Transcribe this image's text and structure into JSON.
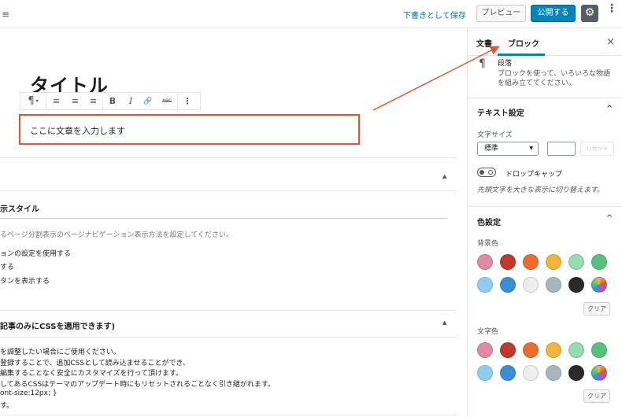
{
  "topbar": {
    "menu_icon": "≡",
    "save_draft": "下書きとして保存",
    "preview": "プレビュー",
    "publish": "公開する",
    "settings_icon": "⚙",
    "more_icon": "⋮"
  },
  "editor": {
    "title": "タイトル",
    "paragraph_text": "ここに文章を入力します",
    "toolbar": {
      "paragraph_icon": "¶",
      "align_left": "≡",
      "align_center": "≡",
      "align_right": "≡",
      "bold": "B",
      "italic": "I",
      "link": "🔗",
      "strikethrough": "ABC",
      "more": "⋮"
    },
    "panel1": {
      "title": "示スタイル",
      "note": "るページ分割表示のページナビゲーション表示方法を設定してください。",
      "options": [
        "ョンの設定を使用する",
        "する",
        "タンを表示する"
      ]
    },
    "panel2": {
      "title": "記事のみにCSSを適用できます)",
      "lines": [
        "を調整したい場合にご使用ください。",
        "登録することで、追加CSSとして読み込ませることができ、",
        "編集することなく安全にカスタマイズを行って頂けます。",
        "してあるCSSはテーマのアップデート時にもリセットされることなく引き継がれます。",
        "ont-size:12px; }",
        "す。"
      ]
    },
    "caret_icon": "▲"
  },
  "sidebar": {
    "tab_document": "文書",
    "tab_block": "ブロック",
    "close_icon": "×",
    "block_icon": "¶",
    "block_name": "段落",
    "block_description": "ブロックを使って、いろいろな物語を組み立ててください。",
    "text_settings": {
      "heading": "テキスト設定",
      "font_size_label": "文字サイズ",
      "font_size_value": "標準",
      "reset": "リセット",
      "drop_cap_label": "ドロップキャップ",
      "drop_cap_help": "先頭文字を大きな表示に切り替えます。"
    },
    "color_settings": {
      "heading": "色設定",
      "background_label": "背景色",
      "text_color_label": "文字色",
      "clear": "クリア",
      "palette": [
        "#e28aa3",
        "#c0392b",
        "#ea6d2f",
        "#f2b53a",
        "#97dbb3",
        "#56c27d",
        "#8fcdf4",
        "#3b8ed6",
        "#eeeeee",
        "#aab4bd",
        "#2a2a2a",
        "gradient"
      ]
    },
    "chevron_icon": "^"
  },
  "colors": {
    "accent": "#0085ba",
    "highlight": "#e0542f"
  }
}
